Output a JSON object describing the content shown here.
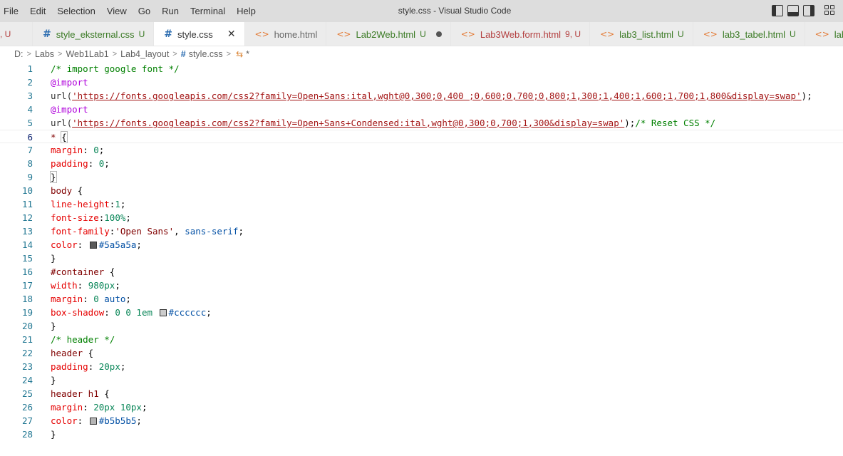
{
  "menu": [
    "File",
    "Edit",
    "Selection",
    "View",
    "Go",
    "Run",
    "Terminal",
    "Help"
  ],
  "window_title": "style.css - Visual Studio Code",
  "tabs": [
    {
      "label": "",
      "status": ", U",
      "kind": "partial"
    },
    {
      "label": "style_eksternal.css",
      "status": "U",
      "kind": "css"
    },
    {
      "label": "style.css",
      "status": "",
      "kind": "css",
      "active": true
    },
    {
      "label": "home.html",
      "status": "",
      "kind": "html"
    },
    {
      "label": "Lab2Web.html",
      "status": "U",
      "kind": "html",
      "dirty": true
    },
    {
      "label": "Lab3Web.form.html",
      "status": "9, U",
      "kind": "html"
    },
    {
      "label": "lab3_list.html",
      "status": "U",
      "kind": "html"
    },
    {
      "label": "lab3_tabel.html",
      "status": "U",
      "kind": "html"
    },
    {
      "label": "lab",
      "status": "",
      "kind": "html"
    }
  ],
  "breadcrumb": {
    "parts": [
      "D:",
      "Labs",
      "Web1Lab1",
      "Lab4_layout"
    ],
    "file": "style.css",
    "symbol": "*"
  },
  "line_numbers": [
    "1",
    "2",
    "3",
    "4",
    "5",
    "6",
    "7",
    "8",
    "9",
    "10",
    "11",
    "12",
    "13",
    "14",
    "15",
    "16",
    "17",
    "18",
    "19",
    "20",
    "21",
    "22",
    "23",
    "24",
    "25",
    "26",
    "27",
    "28"
  ],
  "code": {
    "l1": "/* import google font */",
    "l2": "@import",
    "l3_fn": "url(",
    "l3_str": "'https://fonts.googleapis.com/css2?family=Open+Sans:ital,wght@0,300;0,400 ;0,600;0,700;0,800;1,300;1,400;1,600;1,700;1,800&display=swap'",
    "l3_end": ");",
    "l4": "@import",
    "l5_fn": "url(",
    "l5_str": "'https://fonts.googleapis.com/css2?family=Open+Sans+Condensed:ital,wght@0,300;0,700;1,300&display=swap'",
    "l5_end": ");",
    "l5_comment": "/* Reset CSS */",
    "l6_sel": "* ",
    "l6_brace": "{",
    "l7_prop": "margin",
    "l7_val": "0",
    "l8_prop": "padding",
    "l8_val": "0",
    "l9": "}",
    "l10_sel": "body",
    "l10_brace": " {",
    "l11_prop": "line-height",
    "l11_val": "1",
    "l12_prop": "font-size",
    "l12_val": "100%",
    "l13_prop": "font-family",
    "l13_str": "'Open Sans'",
    "l13_val": "sans-serif",
    "l14_prop": "color",
    "l14_val": "#5a5a5a",
    "l15": "}",
    "l16_sel": "#container",
    "l16_brace": " {",
    "l17_prop": "width",
    "l17_val": "980px",
    "l18_prop": "margin",
    "l18_num": "0",
    "l18_val": "auto",
    "l19_prop": "box-shadow",
    "l19_num": "0 0 1em",
    "l19_val": "#cccccc",
    "l20": "}",
    "l21": "/* header */",
    "l22_sel": "header",
    "l22_brace": " {",
    "l23_prop": "padding",
    "l23_val": "20px",
    "l24": "}",
    "l25_sel": "header h1",
    "l25_brace": " {",
    "l26_prop": "margin",
    "l26_val": "20px 10px",
    "l27_prop": "color",
    "l27_val": "#b5b5b5",
    "l28": "}"
  },
  "colors": {
    "swatch_14": "#5a5a5a",
    "swatch_19": "#cccccc",
    "swatch_27": "#b5b5b5"
  }
}
